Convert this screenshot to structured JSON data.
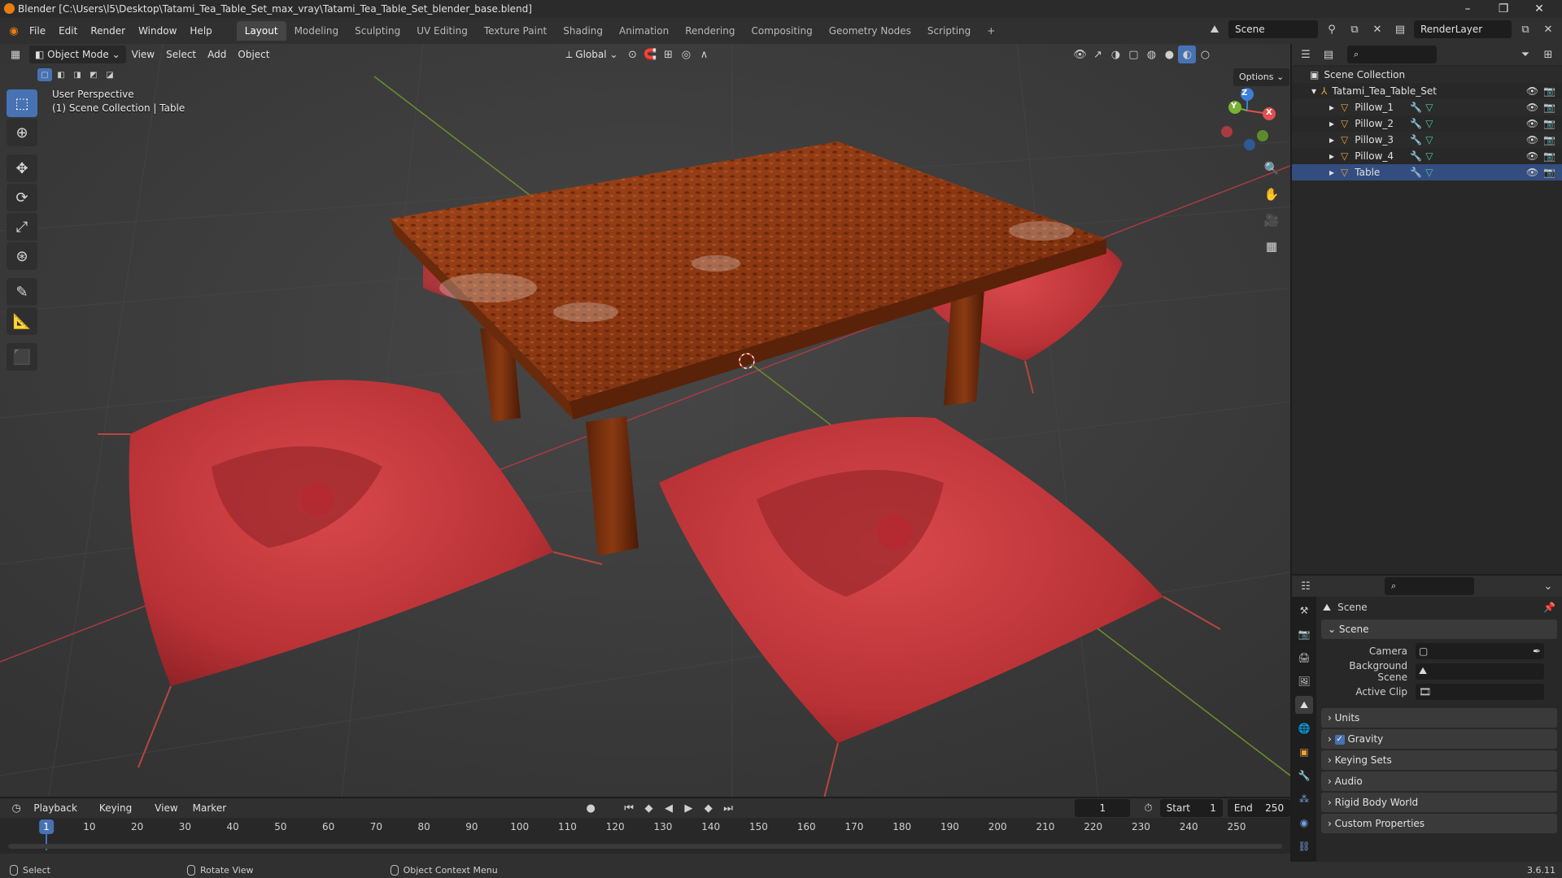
{
  "window": {
    "title": "Blender [C:\\Users\\l5\\Desktop\\Tatami_Tea_Table_Set_max_vray\\Tatami_Tea_Table_Set_blender_base.blend]",
    "minimize": "–",
    "maximize": "❐",
    "close": "✕"
  },
  "menubar": {
    "menus": [
      "File",
      "Edit",
      "Render",
      "Window",
      "Help"
    ],
    "workspaces": [
      "Layout",
      "Modeling",
      "Sculpting",
      "UV Editing",
      "Texture Paint",
      "Shading",
      "Animation",
      "Rendering",
      "Compositing",
      "Geometry Nodes",
      "Scripting"
    ],
    "active_workspace": "Layout",
    "add_tab": "+",
    "scene": "Scene",
    "view_layer": "RenderLayer"
  },
  "viewport": {
    "mode": "Object Mode",
    "menus": [
      "View",
      "Select",
      "Add",
      "Object"
    ],
    "transform_orientation": "Global",
    "options": "Options",
    "overlay_line1": "User Perspective",
    "overlay_line2": "(1) Scene Collection | Table",
    "gizmo": {
      "x": "X",
      "y": "Y",
      "z": "Z"
    }
  },
  "outliner": {
    "root": "Scene Collection",
    "collection": "Tatami_Tea_Table_Set",
    "objects": [
      "Pillow_1",
      "Pillow_2",
      "Pillow_3",
      "Pillow_4",
      "Table"
    ]
  },
  "properties": {
    "context": "Scene",
    "panel_title": "Scene",
    "camera_label": "Camera",
    "background_scene_label": "Background Scene",
    "active_clip_label": "Active Clip",
    "subpanels": [
      "Units",
      "Gravity",
      "Keying Sets",
      "Audio",
      "Rigid Body World",
      "Custom Properties"
    ]
  },
  "timeline": {
    "menus": [
      "Playback",
      "Keying",
      "View",
      "Marker"
    ],
    "current_frame": "1",
    "start_label": "Start",
    "start": "1",
    "end_label": "End",
    "end": "250",
    "ticks": [
      "1",
      "10",
      "20",
      "30",
      "40",
      "50",
      "60",
      "70",
      "80",
      "90",
      "100",
      "110",
      "120",
      "130",
      "140",
      "150",
      "160",
      "170",
      "180",
      "190",
      "200",
      "210",
      "220",
      "230",
      "240",
      "250"
    ]
  },
  "statusbar": {
    "select": "Select",
    "rotate_view": "Rotate View",
    "context_menu": "Object Context Menu",
    "version": "3.6.11"
  },
  "colors": {
    "accent": "#4772b3",
    "pillow": "#c23a3e",
    "table": "#8a3a12"
  }
}
